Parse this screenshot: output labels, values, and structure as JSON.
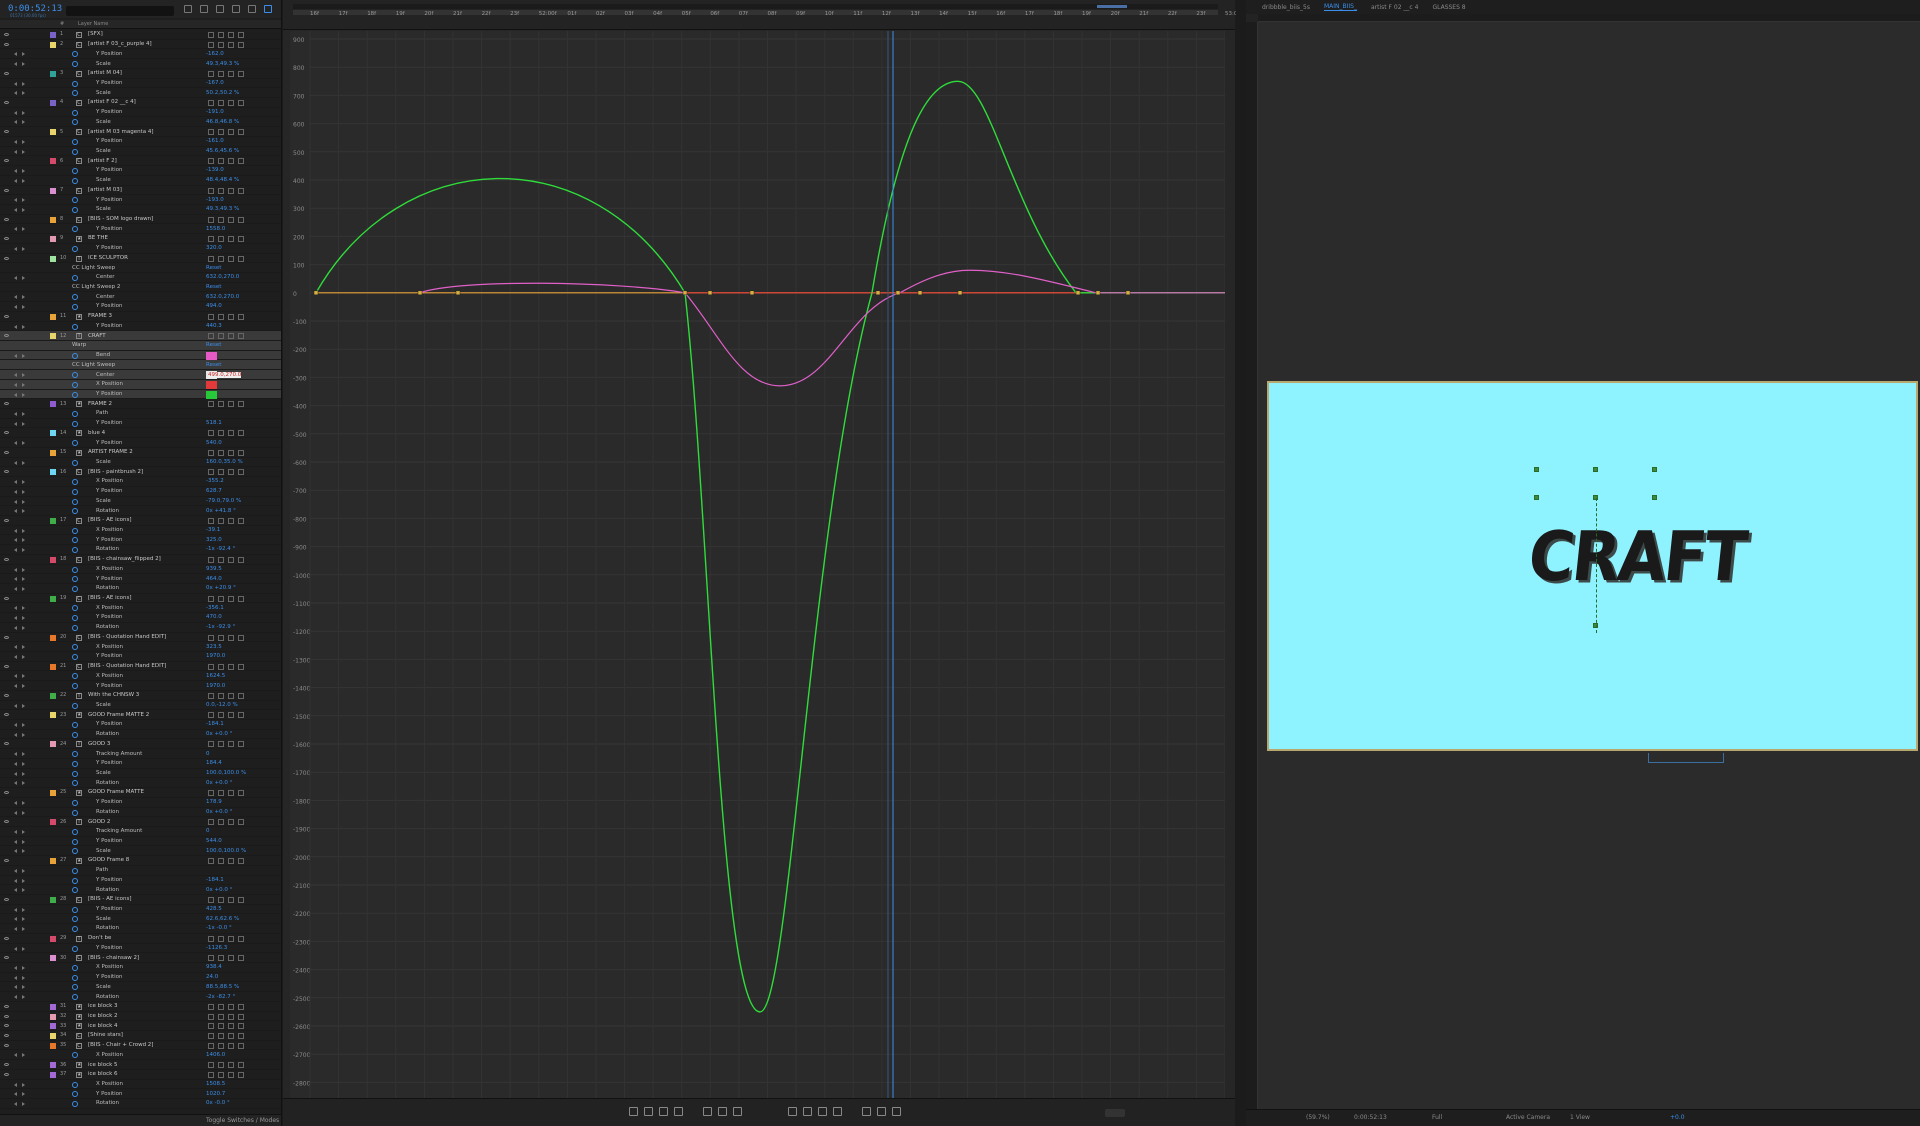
{
  "timecode": "0:00:52:13",
  "fps": "01573 (30.00 fps)",
  "panel_header": {
    "layer_name": "Layer Name",
    "num_col": "#"
  },
  "footer": {
    "toggle": "Toggle Switches / Modes"
  },
  "layers": [
    {
      "t": "L",
      "n": "1",
      "name": "[SFX]",
      "c": "#7a63c7",
      "ic": "C"
    },
    {
      "t": "L",
      "n": "2",
      "name": "[artist F 03_c_purple 4]",
      "c": "#e8d46a",
      "ic": "C"
    },
    {
      "t": "P",
      "name": "Y Position",
      "v": "-162.0"
    },
    {
      "t": "P",
      "name": "Scale",
      "v": "49.3,49.3 %"
    },
    {
      "t": "L",
      "n": "3",
      "name": "[artist M 04]",
      "c": "#2fa39a",
      "ic": "C"
    },
    {
      "t": "P",
      "name": "Y Position",
      "v": "-167.0"
    },
    {
      "t": "P",
      "name": "Scale",
      "v": "50.2,50.2 %"
    },
    {
      "t": "L",
      "n": "4",
      "name": "[artist F 02 __c 4]",
      "c": "#7a63c7",
      "ic": "C"
    },
    {
      "t": "P",
      "name": "Y Position",
      "v": "-191.0"
    },
    {
      "t": "P",
      "name": "Scale",
      "v": "46.8,46.8 %"
    },
    {
      "t": "L",
      "n": "5",
      "name": "[artist M 03 magenta 4]",
      "c": "#e8d46a",
      "ic": "C"
    },
    {
      "t": "P",
      "name": "Y Position",
      "v": "-161.0"
    },
    {
      "t": "P",
      "name": "Scale",
      "v": "45.6,45.6 %"
    },
    {
      "t": "L",
      "n": "6",
      "name": "[artist F 2]",
      "c": "#d54a6b",
      "ic": "C"
    },
    {
      "t": "P",
      "name": "Y Position",
      "v": "-139.0"
    },
    {
      "t": "P",
      "name": "Scale",
      "v": "48.4,48.4 %"
    },
    {
      "t": "L",
      "n": "7",
      "name": "[artist M 03]",
      "c": "#d98fd0",
      "ic": "C"
    },
    {
      "t": "P",
      "name": "Y Position",
      "v": "-193.0"
    },
    {
      "t": "P",
      "name": "Scale",
      "v": "49.3,49.3 %"
    },
    {
      "t": "L",
      "n": "8",
      "name": "[BIIS - SOM logo drawn]",
      "c": "#e8a23a",
      "ic": "C"
    },
    {
      "t": "P",
      "name": "Y Position",
      "v": "1558.0"
    },
    {
      "t": "L",
      "n": "9",
      "name": "BE THE",
      "c": "#e39ab0",
      "ic": "★"
    },
    {
      "t": "P",
      "name": "Y Position",
      "v": "320.0"
    },
    {
      "t": "L",
      "n": "10",
      "name": "ICE SCULPTOR",
      "c": "#9ee3a0",
      "ic": "T"
    },
    {
      "t": "E",
      "name": "CC Light Sweep",
      "v": "Reset"
    },
    {
      "t": "P",
      "name": "Center",
      "v": "632.0,270.0"
    },
    {
      "t": "E",
      "name": "CC Light Sweep 2",
      "v": "Reset"
    },
    {
      "t": "P",
      "name": "Center",
      "v": "632.0,270.0"
    },
    {
      "t": "P",
      "name": "Y Position",
      "v": "494.0"
    },
    {
      "t": "L",
      "n": "11",
      "name": "FRAME 3",
      "c": "#e8a23a",
      "ic": "★"
    },
    {
      "t": "P",
      "name": "Y Position",
      "v": "440.3"
    },
    {
      "t": "L",
      "n": "12",
      "name": "CRAFT",
      "c": "#e8d46a",
      "ic": "T",
      "sel": true
    },
    {
      "t": "E",
      "name": "Warp",
      "v": "Reset",
      "sel": true
    },
    {
      "t": "P",
      "name": "Bend",
      "v": "",
      "box": "#e65ac8",
      "sel": true
    },
    {
      "t": "E",
      "name": "CC Light Sweep",
      "v": "Reset",
      "sel": true
    },
    {
      "t": "P",
      "name": "Center",
      "v": "499.0,270.0",
      "box": "",
      "sel": true
    },
    {
      "t": "P",
      "name": "X Position",
      "v": "",
      "box": "#e23a3a",
      "sel": true
    },
    {
      "t": "P",
      "name": "Y Position",
      "v": "",
      "box": "#27c93a",
      "sel": true
    },
    {
      "t": "L",
      "n": "13",
      "name": "FRAME 2",
      "c": "#8f5bd1",
      "ic": "★"
    },
    {
      "t": "P",
      "name": "Path",
      "v": ""
    },
    {
      "t": "P",
      "name": "Y Position",
      "v": "518.1"
    },
    {
      "t": "L",
      "n": "14",
      "name": "blue 4",
      "c": "#6fd6f2",
      "ic": "★"
    },
    {
      "t": "P",
      "name": "Y Position",
      "v": "540.0"
    },
    {
      "t": "L",
      "n": "15",
      "name": "ARTIST FRAME 2",
      "c": "#e8a23a",
      "ic": "★"
    },
    {
      "t": "P",
      "name": "Scale",
      "v": "160.0,35.0 %"
    },
    {
      "t": "L",
      "n": "16",
      "name": "[BIIS - paintbrush 2]",
      "c": "#6fd6f2",
      "ic": "C"
    },
    {
      "t": "P",
      "name": "X Position",
      "v": "-355.2"
    },
    {
      "t": "P",
      "name": "Y Position",
      "v": "628.7"
    },
    {
      "t": "P",
      "name": "Scale",
      "v": "-79.0,79.0 %"
    },
    {
      "t": "P",
      "name": "Rotation",
      "v": "0x +41.8 °"
    },
    {
      "t": "L",
      "n": "17",
      "name": "[BIIS - AE icons]",
      "c": "#3fae4a",
      "ic": "C"
    },
    {
      "t": "P",
      "name": "X Position",
      "v": "-39.1"
    },
    {
      "t": "P",
      "name": "Y Position",
      "v": "325.0"
    },
    {
      "t": "P",
      "name": "Rotation",
      "v": "-1x -92.4 °"
    },
    {
      "t": "L",
      "n": "18",
      "name": "[BIIS - chainsaw_flipped 2]",
      "c": "#d54a6b",
      "ic": "C"
    },
    {
      "t": "P",
      "name": "X Position",
      "v": "939.5"
    },
    {
      "t": "P",
      "name": "Y Position",
      "v": "464.0"
    },
    {
      "t": "P",
      "name": "Rotation",
      "v": "0x +20.9 °"
    },
    {
      "t": "L",
      "n": "19",
      "name": "[BIIS - AE icons]",
      "c": "#3fae4a",
      "ic": "C"
    },
    {
      "t": "P",
      "name": "X Position",
      "v": "-356.1"
    },
    {
      "t": "P",
      "name": "Y Position",
      "v": "470.0"
    },
    {
      "t": "P",
      "name": "Rotation",
      "v": "-1x -92.9 °"
    },
    {
      "t": "L",
      "n": "20",
      "name": "[BIIS - Quotation Hand EDIT]",
      "c": "#e8772a",
      "ic": "C"
    },
    {
      "t": "P",
      "name": "X Position",
      "v": "323.5"
    },
    {
      "t": "P",
      "name": "Y Position",
      "v": "1970.0"
    },
    {
      "t": "L",
      "n": "21",
      "name": "[BIIS - Quotation Hand EDIT]",
      "c": "#e8772a",
      "ic": "C"
    },
    {
      "t": "P",
      "name": "X Position",
      "v": "1624.5"
    },
    {
      "t": "P",
      "name": "Y Position",
      "v": "1970.0"
    },
    {
      "t": "L",
      "n": "22",
      "name": "With the CHNSW 3",
      "c": "#3fae4a",
      "ic": "T"
    },
    {
      "t": "P",
      "name": "Scale",
      "v": "0.0,-12.0 %"
    },
    {
      "t": "L",
      "n": "23",
      "name": "GOOD Frame MATTE 2",
      "c": "#e8d46a",
      "ic": "★"
    },
    {
      "t": "P",
      "name": "Y Position",
      "v": "-184.1"
    },
    {
      "t": "P",
      "name": "Rotation",
      "v": "0x +0.0 °"
    },
    {
      "t": "L",
      "n": "24",
      "name": "GOOD 3",
      "c": "#e39ab0",
      "ic": "T"
    },
    {
      "t": "P",
      "name": "Tracking Amount",
      "v": "0"
    },
    {
      "t": "P",
      "name": "Y Position",
      "v": "184.4"
    },
    {
      "t": "P",
      "name": "Scale",
      "v": "100.0,100.0 %"
    },
    {
      "t": "P",
      "name": "Rotation",
      "v": "0x +0.0 °"
    },
    {
      "t": "L",
      "n": "25",
      "name": "GOOD Frame MATTE",
      "c": "#e8a23a",
      "ic": "★"
    },
    {
      "t": "P",
      "name": "Y Position",
      "v": "178.9"
    },
    {
      "t": "P",
      "name": "Rotation",
      "v": "0x +0.0 °"
    },
    {
      "t": "L",
      "n": "26",
      "name": "GOOD 2",
      "c": "#d54a6b",
      "ic": "T"
    },
    {
      "t": "P",
      "name": "Tracking Amount",
      "v": "0"
    },
    {
      "t": "P",
      "name": "Y Position",
      "v": "544.0"
    },
    {
      "t": "P",
      "name": "Scale",
      "v": "100.0,100.0 %"
    },
    {
      "t": "L",
      "n": "27",
      "name": "GOOD Frame 8",
      "c": "#e8a23a",
      "ic": "★"
    },
    {
      "t": "P",
      "name": "Path",
      "v": ""
    },
    {
      "t": "P",
      "name": "Y Position",
      "v": "-184.1"
    },
    {
      "t": "P",
      "name": "Rotation",
      "v": "0x +0.0 °"
    },
    {
      "t": "L",
      "n": "28",
      "name": "[BIIS - AE icons]",
      "c": "#3fae4a",
      "ic": "C"
    },
    {
      "t": "P",
      "name": "Y Position",
      "v": "428.5"
    },
    {
      "t": "P",
      "name": "Scale",
      "v": "62.6,62.6 %"
    },
    {
      "t": "P",
      "name": "Rotation",
      "v": "-1x -0.0 °"
    },
    {
      "t": "L",
      "n": "29",
      "name": "Don't be",
      "c": "#d54a6b",
      "ic": "T"
    },
    {
      "t": "P",
      "name": "Y Position",
      "v": "-1126.3"
    },
    {
      "t": "L",
      "n": "30",
      "name": "[BIIS - chainsaw 2]",
      "c": "#d98fd0",
      "ic": "C"
    },
    {
      "t": "P",
      "name": "X Position",
      "v": "938.4"
    },
    {
      "t": "P",
      "name": "Y Position",
      "v": "24.0"
    },
    {
      "t": "P",
      "name": "Scale",
      "v": "88.5,88.5 %"
    },
    {
      "t": "P",
      "name": "Rotation",
      "v": "-2x -82.7 °"
    },
    {
      "t": "L",
      "n": "31",
      "name": "ice block 3",
      "c": "#a36ad6",
      "ic": "★"
    },
    {
      "t": "L",
      "n": "32",
      "name": "ice block 2",
      "c": "#e39ab0",
      "ic": "★"
    },
    {
      "t": "L",
      "n": "33",
      "name": "ice block 4",
      "c": "#a36ad6",
      "ic": "★"
    },
    {
      "t": "L",
      "n": "34",
      "name": "[Shine stars]",
      "c": "#e8d46a",
      "ic": "C"
    },
    {
      "t": "L",
      "n": "35",
      "name": "[BIIS - Chair + Crowd 2]",
      "c": "#e8772a",
      "ic": "C"
    },
    {
      "t": "P",
      "name": "X Position",
      "v": "1406.0"
    },
    {
      "t": "L",
      "n": "36",
      "name": "ice block 5",
      "c": "#a36ad6",
      "ic": "★"
    },
    {
      "t": "L",
      "n": "37",
      "name": "ice block 6",
      "c": "#a36ad6",
      "ic": "★"
    },
    {
      "t": "P",
      "name": "X Position",
      "v": "1508.5"
    },
    {
      "t": "P",
      "name": "Y Position",
      "v": "1020.7"
    },
    {
      "t": "P",
      "name": "Rotation",
      "v": "0x -0.0 °"
    }
  ],
  "graph": {
    "time_labels": [
      "16f",
      "17f",
      "18f",
      "19f",
      "20f",
      "21f",
      "22f",
      "23f",
      "52:00f",
      "01f",
      "02f",
      "03f",
      "04f",
      "05f",
      "06f",
      "07f",
      "08f",
      "09f",
      "10f",
      "11f",
      "12f",
      "13f",
      "14f",
      "15f",
      "16f",
      "17f",
      "18f",
      "19f",
      "20f",
      "21f",
      "22f",
      "23f",
      "53:00f"
    ],
    "value_labels": [
      "900",
      "800",
      "700",
      "600",
      "500",
      "400",
      "300",
      "200",
      "100",
      "0",
      "-100",
      "-200",
      "-300",
      "-400",
      "-500",
      "-600",
      "-700",
      "-800",
      "-900",
      "-1000",
      "-1100",
      "-1200",
      "-1300",
      "-1400",
      "-1500",
      "-1600",
      "-1700",
      "-1800",
      "-1900",
      "-2000",
      "-2100",
      "-2200",
      "-2300",
      "-2400",
      "-2500",
      "-2600",
      "-2700",
      "-2800"
    ],
    "colors": {
      "green": "#2fdc3a",
      "pink": "#e060c8",
      "red": "#e23a3a",
      "orange": "#e8a23a",
      "playhead": "#3b8fea"
    }
  },
  "comp": {
    "tabs": [
      "dribbble_biis_5s",
      "MAIN_BIIS_",
      "artist F 02 __c 4",
      "GLASSES 8"
    ],
    "active_tab": 1,
    "headline": "CRAFT",
    "bg_color": "#8ff2ff",
    "footer": {
      "zoom": "(59.7%)",
      "time": "0:00:52:13",
      "res": "Full",
      "camera": "Active Camera",
      "view": "1 View",
      "offset": "+0.0"
    }
  }
}
